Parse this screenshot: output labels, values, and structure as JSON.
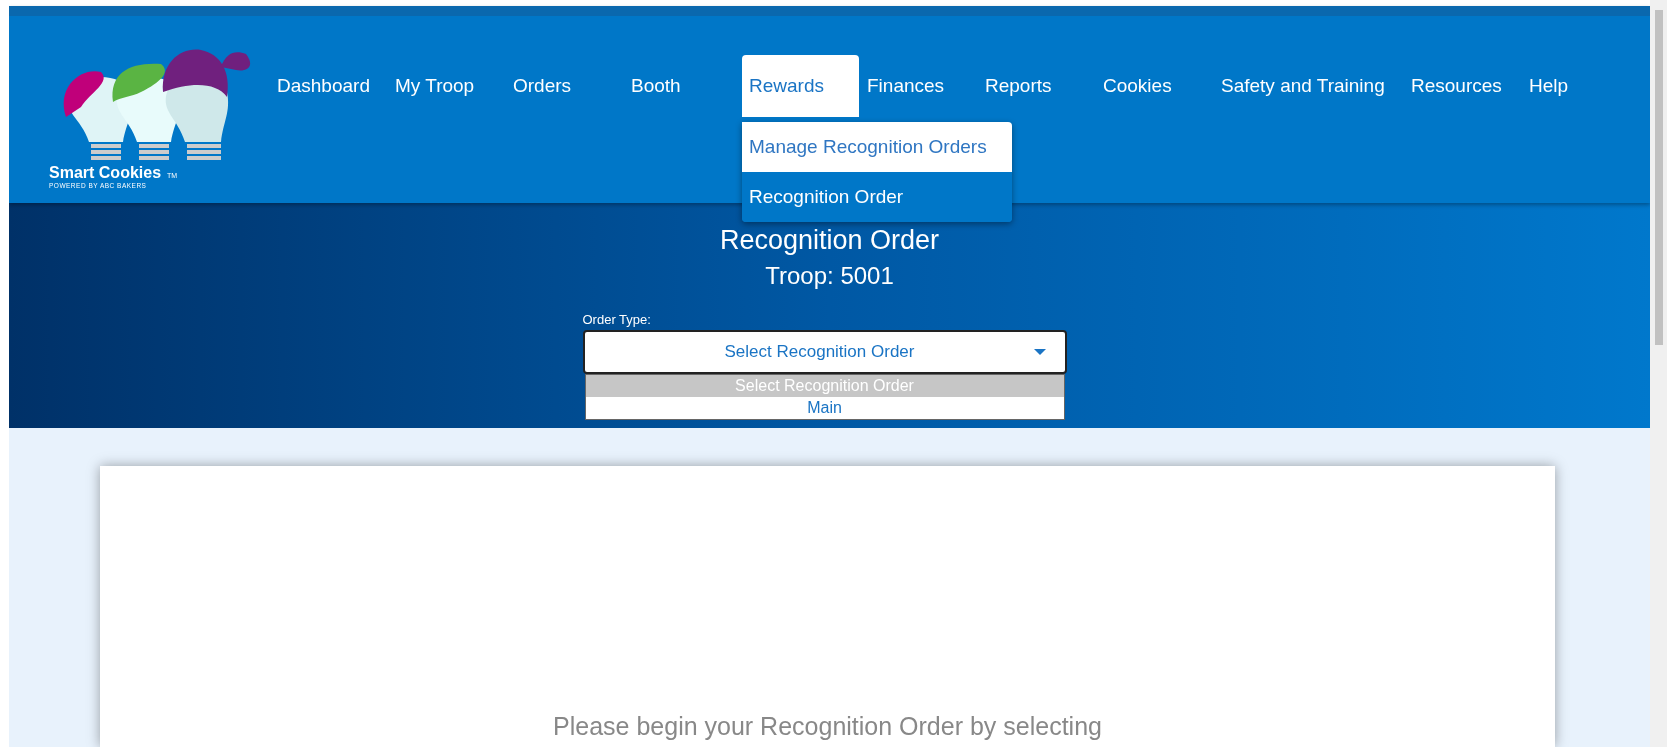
{
  "logo": {
    "name": "Smart Cookies",
    "trademark": "TM",
    "tagline": "POWERED BY ABC BAKERS"
  },
  "nav": [
    {
      "label": "Dashboard",
      "selected": false
    },
    {
      "label": "My Troop",
      "selected": false
    },
    {
      "label": "Orders",
      "selected": false
    },
    {
      "label": "Booth",
      "selected": false
    },
    {
      "label": "Rewards",
      "selected": true,
      "menu": [
        {
          "label": "Manage Recognition Orders",
          "selected": false
        },
        {
          "label": "Recognition Order",
          "selected": true
        }
      ]
    },
    {
      "label": "Finances",
      "selected": false
    },
    {
      "label": "Reports",
      "selected": false
    },
    {
      "label": "Cookies",
      "selected": false
    },
    {
      "label": "Safety and Training",
      "selected": false
    },
    {
      "label": "Resources",
      "selected": false
    },
    {
      "label": "Help",
      "selected": false
    }
  ],
  "page": {
    "title": "Recognition Order",
    "subtitle": "Troop: 5001"
  },
  "order_type": {
    "label": "Order Type:",
    "value": "Select Recognition Order",
    "expanded": true,
    "options": [
      {
        "label": "Select Recognition Order",
        "selected": true
      },
      {
        "label": "Main",
        "selected": false
      }
    ]
  },
  "card": {
    "message": "Please begin your Recognition Order by selecting"
  }
}
